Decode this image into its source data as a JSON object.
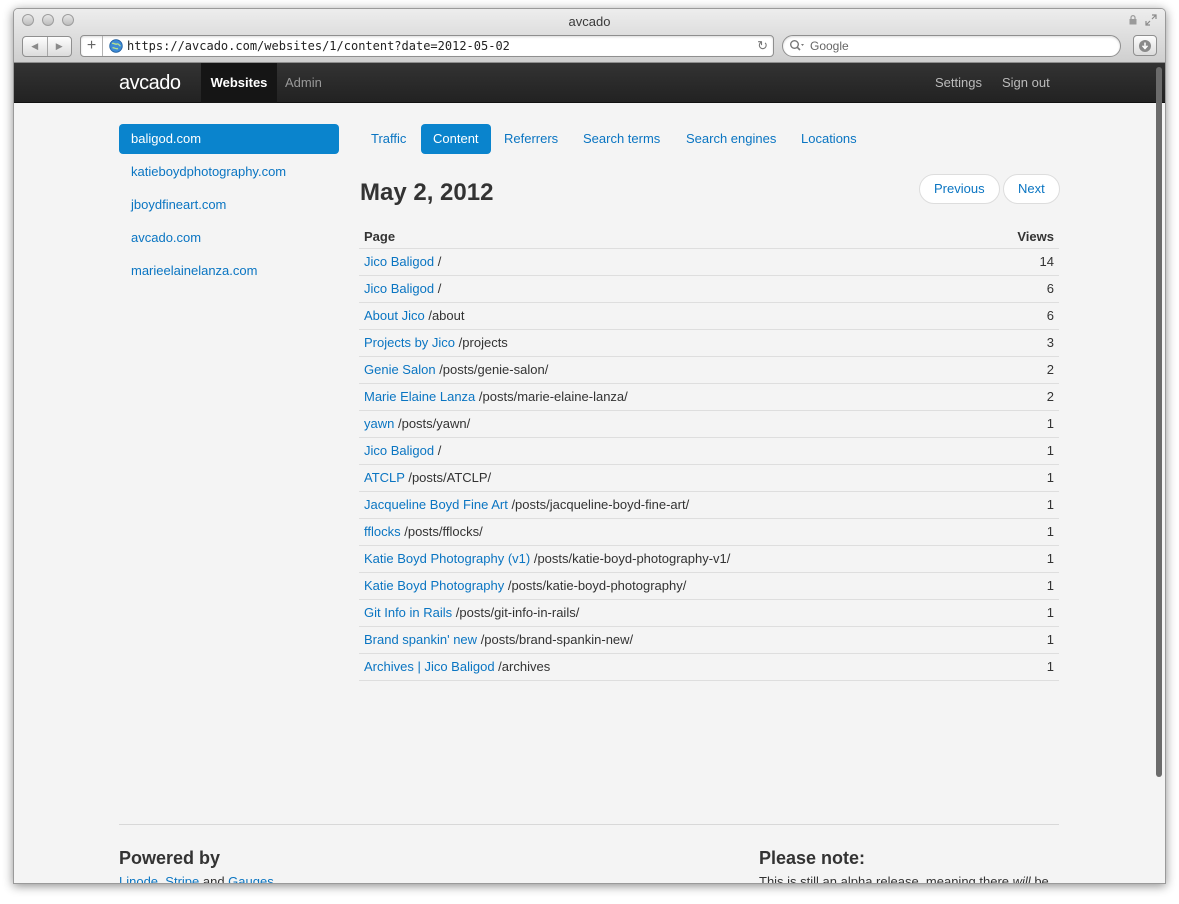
{
  "window": {
    "title": "avcado"
  },
  "browser": {
    "url": "https://avcado.com/websites/1/content?date=2012-05-02",
    "search_placeholder": "Google"
  },
  "appnav": {
    "brand": "avcado",
    "websites_label": "Websites",
    "admin_label": "Admin",
    "settings_label": "Settings",
    "signout_label": "Sign out"
  },
  "sites": [
    {
      "label": "baligod.com",
      "active": true
    },
    {
      "label": "katieboydphotography.com",
      "active": false
    },
    {
      "label": "jboydfineart.com",
      "active": false
    },
    {
      "label": "avcado.com",
      "active": false
    },
    {
      "label": "marieelainelanza.com",
      "active": false
    }
  ],
  "tabs": [
    {
      "label": "Traffic",
      "active": false
    },
    {
      "label": "Content",
      "active": true
    },
    {
      "label": "Referrers",
      "active": false
    },
    {
      "label": "Search terms",
      "active": false
    },
    {
      "label": "Search engines",
      "active": false
    },
    {
      "label": "Locations",
      "active": false
    }
  ],
  "content": {
    "date_title": "May 2, 2012",
    "previous_label": "Previous",
    "next_label": "Next",
    "columns": {
      "page": "Page",
      "views": "Views"
    },
    "rows": [
      {
        "title": "Jico Baligod",
        "path": "/",
        "views": "14"
      },
      {
        "title": "Jico Baligod",
        "path": "/",
        "views": "6"
      },
      {
        "title": "About Jico",
        "path": "/about",
        "views": "6"
      },
      {
        "title": "Projects by Jico",
        "path": "/projects",
        "views": "3"
      },
      {
        "title": "Genie Salon",
        "path": "/posts/genie-salon/",
        "views": "2"
      },
      {
        "title": "Marie Elaine Lanza",
        "path": "/posts/marie-elaine-lanza/",
        "views": "2"
      },
      {
        "title": "yawn",
        "path": "/posts/yawn/",
        "views": "1"
      },
      {
        "title": "Jico Baligod",
        "path": "/",
        "views": "1"
      },
      {
        "title": "ATCLP",
        "path": "/posts/ATCLP/",
        "views": "1"
      },
      {
        "title": "Jacqueline Boyd Fine Art",
        "path": "/posts/jacqueline-boyd-fine-art/",
        "views": "1"
      },
      {
        "title": "fflocks",
        "path": "/posts/fflocks/",
        "views": "1"
      },
      {
        "title": "Katie Boyd Photography (v1)",
        "path": "/posts/katie-boyd-photography-v1/",
        "views": "1"
      },
      {
        "title": "Katie Boyd Photography",
        "path": "/posts/katie-boyd-photography/",
        "views": "1"
      },
      {
        "title": "Git Info in Rails",
        "path": "/posts/git-info-in-rails/",
        "views": "1"
      },
      {
        "title": "Brand spankin' new",
        "path": "/posts/brand-spankin-new/",
        "views": "1"
      },
      {
        "title": "Archives | Jico Baligod",
        "path": "/archives",
        "views": "1"
      }
    ]
  },
  "footer": {
    "powered_heading": "Powered by",
    "link_linode": "Linode",
    "sep1": ", ",
    "link_stripe": "Stripe",
    "sep2": " and ",
    "link_gauges": "Gauges",
    "note_heading": "Please note:",
    "note_text_before": "This is still an alpha release, meaning there ",
    "note_text_em": "will",
    "note_text_after": " be"
  }
}
